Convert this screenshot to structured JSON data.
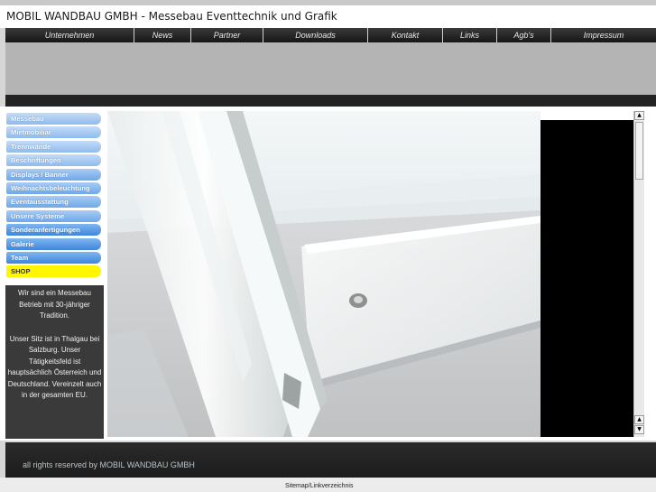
{
  "header": {
    "title": "MOBIL WANDBAU GMBH - Messebau Eventtechnik und Grafik"
  },
  "nav": {
    "items": [
      {
        "label": "Unternehmen"
      },
      {
        "label": "News"
      },
      {
        "label": "Partner"
      },
      {
        "label": "Downloads"
      },
      {
        "label": "Kontakt"
      },
      {
        "label": "Links"
      },
      {
        "label": "Agb's"
      },
      {
        "label": "Impressum"
      }
    ]
  },
  "sidebar": {
    "items": [
      {
        "label": "Messebau"
      },
      {
        "label": "Mietmobiliar"
      },
      {
        "label": "Trennwände"
      },
      {
        "label": "Beschriftungen"
      },
      {
        "label": "Displays / Banner"
      },
      {
        "label": "Weihnachtsbeleuchtung"
      },
      {
        "label": "Eventausstattung"
      },
      {
        "label": "Unsere Systeme"
      },
      {
        "label": "Sonderanfertigungen"
      },
      {
        "label": "Galerie"
      },
      {
        "label": "Team"
      },
      {
        "label": "SHOP"
      }
    ],
    "info_intro": "Wir sind ein Messebau Betrieb mit 30-jähriger Tradition.",
    "info_body": "Unser Sitz ist in Thalgau bei Salzburg. Unser Tätigkeitsfeld ist hauptsächlich Österreich und Deutschland. Vereinzelt auch in der gesamten EU."
  },
  "footer": {
    "text": "all rights reserved by MOBIL WANDBAU GMBH"
  },
  "sitemap": {
    "text": "Sitemap/Linkverzeichnis"
  },
  "colors": {
    "shop": "#fff700",
    "menu_blue": "#6ea8e8",
    "dark": "#1e1e1e"
  }
}
